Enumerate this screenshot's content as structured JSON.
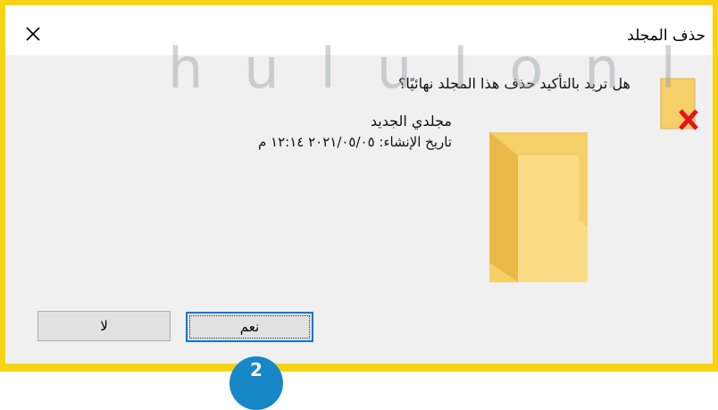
{
  "dialog": {
    "title": "حذف المجلد",
    "question": "هل تريد بالتأكيد حذف هذا المجلد نهائيًا؟",
    "folder_name": "مجلدي الجديد",
    "created_label": "تاريخ الإنشاء: ٢٠٢١/٠٥/٠٥ ١٢:١٤ م",
    "close_symbol": "✕"
  },
  "buttons": {
    "yes_label": "نعم",
    "no_label": "لا"
  },
  "step_badge": "2",
  "watermark": {
    "latin": "hululonl"
  },
  "colors": {
    "frame": "#f7d413",
    "folder": "#f5cf68",
    "delete_x": "#e81123",
    "focus": "#0078d7",
    "badge": "#1787c7"
  },
  "icons": [
    "close-icon",
    "folder-delete-icon",
    "folder-icon"
  ]
}
